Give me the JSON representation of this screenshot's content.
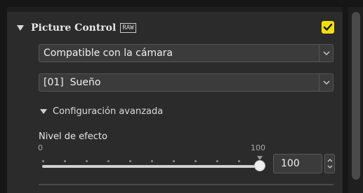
{
  "picture_control": {
    "title": "Picture Control",
    "raw_badge": "RAW",
    "enabled": true,
    "accent_color": "#f5e000"
  },
  "dropdowns": {
    "profile_source": "Compatible con la cámara",
    "profile": "[01]  Sueño"
  },
  "advanced": {
    "label": "Configuración avanzada"
  },
  "effect_level": {
    "label": "Nivel de efecto",
    "min_label": "0",
    "max_label": "100",
    "value": 100,
    "value_text": "100"
  },
  "icons": {
    "collapse": "triangle-down-icon",
    "checkbox": "checkmark-icon",
    "dropdown": "chevron-down-icon",
    "stepper": "up-down-arrows-icon"
  }
}
